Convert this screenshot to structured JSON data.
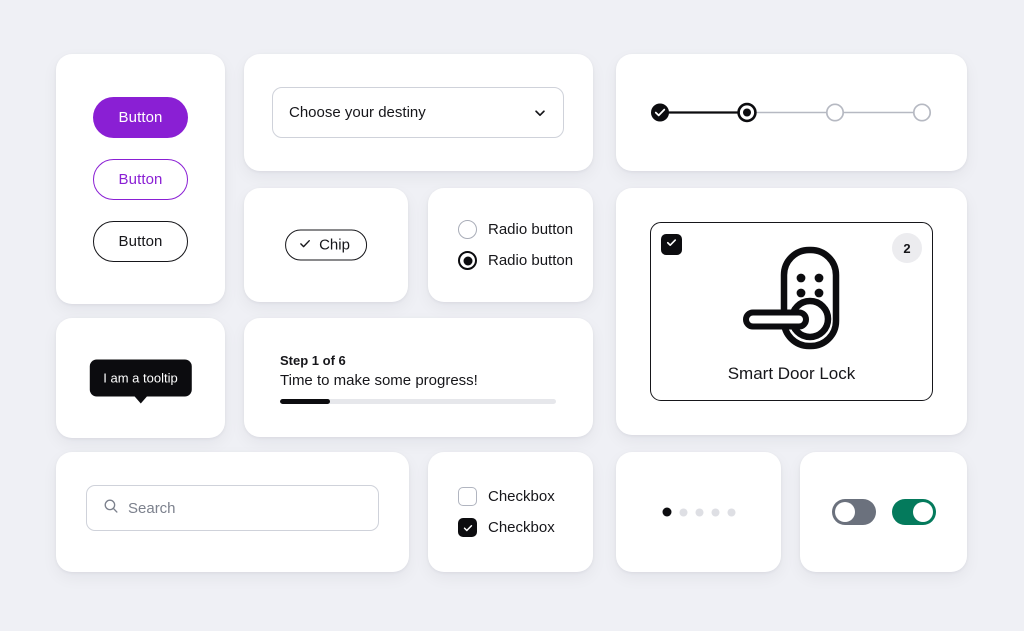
{
  "theme": {
    "background": "#eff0f5",
    "card_background": "#ffffff",
    "accent_purple": "#8a1fd4",
    "accent_green": "#047a5c",
    "ink": "#16161a",
    "muted": "#7c818d"
  },
  "buttons": {
    "filled_label": "Button",
    "outline_purple_label": "Button",
    "outline_dark_label": "Button"
  },
  "select": {
    "value": "Choose your destiny",
    "icon": "chevron-down-icon"
  },
  "stepper": {
    "steps": [
      {
        "state": "completed",
        "icon": "check-icon"
      },
      {
        "state": "current",
        "icon": "dot-icon"
      },
      {
        "state": "inactive",
        "icon": ""
      },
      {
        "state": "inactive",
        "icon": ""
      }
    ],
    "total": 4
  },
  "chip": {
    "label": "Chip",
    "icon": "check-icon",
    "selected": true
  },
  "radio_group": {
    "options": [
      {
        "label": "Radio button",
        "selected": false
      },
      {
        "label": "Radio button",
        "selected": true
      }
    ]
  },
  "product_card": {
    "title": "Smart Door Lock",
    "badge": "2",
    "selected": true,
    "checkbox_icon": "check-icon",
    "product_icon": "smart-door-lock-icon"
  },
  "tooltip": {
    "text": "I am a tooltip"
  },
  "progress": {
    "step_text": "Step 1 of 6",
    "message": "Time to make some progress!",
    "current_step": 1,
    "total_steps": 6,
    "percent": 18
  },
  "search": {
    "placeholder": "Search",
    "value": "",
    "icon": "search-icon"
  },
  "checkboxes": {
    "options": [
      {
        "label": "Checkbox",
        "checked": false
      },
      {
        "label": "Checkbox",
        "checked": true
      }
    ]
  },
  "pagination_dots": {
    "count": 5,
    "active_index": 0
  },
  "toggles": {
    "items": [
      {
        "state": "off",
        "on": false
      },
      {
        "state": "on",
        "on": true
      }
    ]
  }
}
